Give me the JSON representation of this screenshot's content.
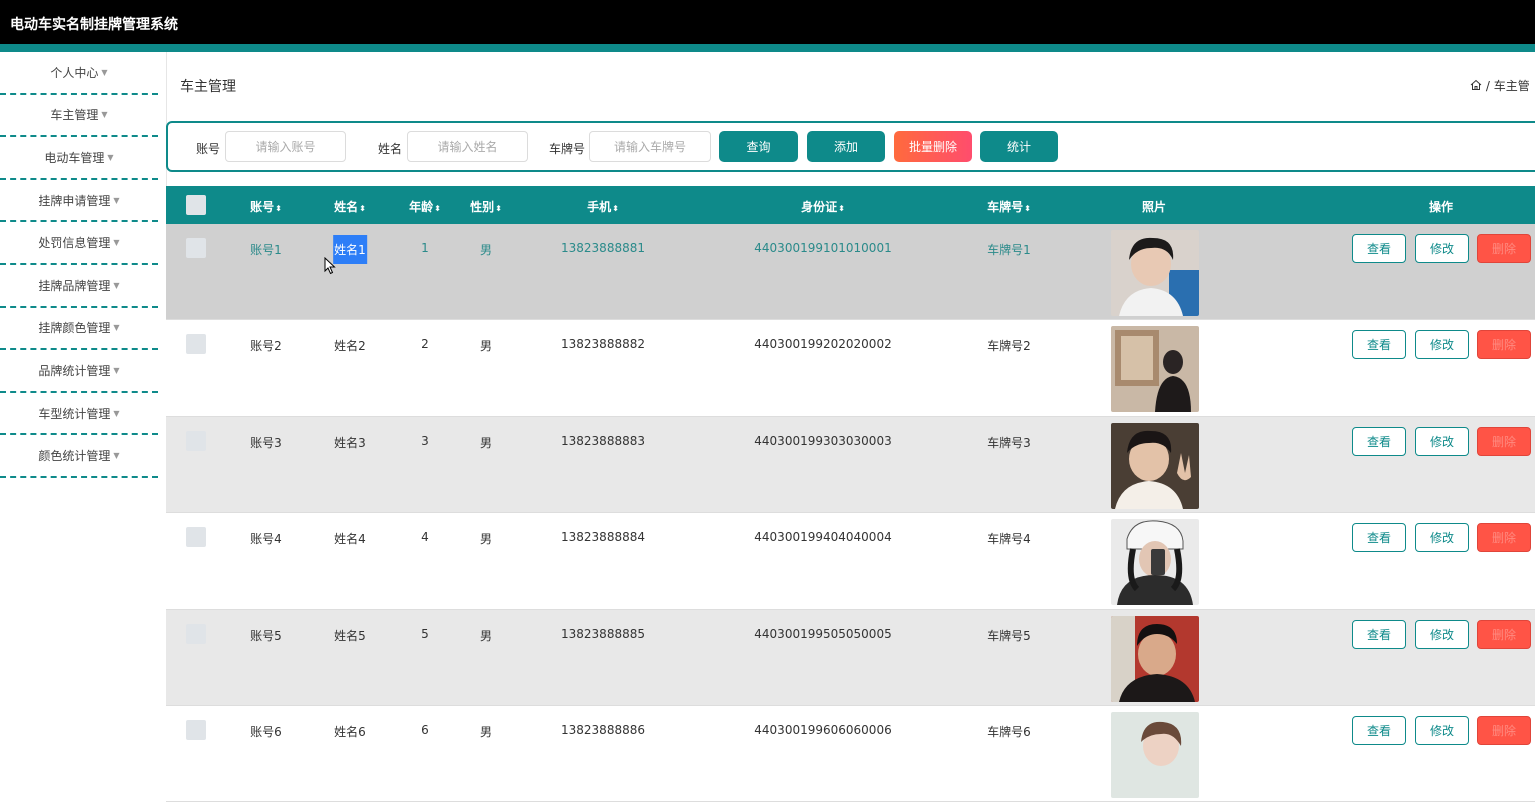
{
  "app": {
    "title": "电动车实名制挂牌管理系统"
  },
  "sidebar": {
    "items": [
      {
        "label": "个人中心"
      },
      {
        "label": "车主管理"
      },
      {
        "label": "电动车管理"
      },
      {
        "label": "挂牌申请管理"
      },
      {
        "label": "处罚信息管理"
      },
      {
        "label": "挂牌品牌管理"
      },
      {
        "label": "挂牌颜色管理"
      },
      {
        "label": "品牌统计管理"
      },
      {
        "label": "车型统计管理"
      },
      {
        "label": "颜色统计管理"
      }
    ]
  },
  "page": {
    "title": "车主管理",
    "breadcrumb_sep": "/",
    "breadcrumb_current": "车主管"
  },
  "search": {
    "account_label": "账号",
    "account_placeholder": "请输入账号",
    "name_label": "姓名",
    "name_placeholder": "请输入姓名",
    "plate_label": "车牌号",
    "plate_placeholder": "请输入车牌号",
    "query_btn": "查询",
    "add_btn": "添加",
    "batch_delete_btn": "批量删除",
    "stats_btn": "统计"
  },
  "table": {
    "headers": {
      "account": "账号",
      "name": "姓名",
      "age": "年龄",
      "gender": "性别",
      "phone": "手机",
      "idcard": "身份证",
      "plate": "车牌号",
      "photo": "照片",
      "ops": "操作"
    },
    "sort_glyph": "⬍",
    "actions": {
      "view": "查看",
      "edit": "修改",
      "delete": "删除"
    },
    "rows": [
      {
        "account": "账号1",
        "name": "姓名1",
        "age": "1",
        "gender": "男",
        "phone": "13823888881",
        "idcard": "440300199101010001",
        "plate": "车牌号1"
      },
      {
        "account": "账号2",
        "name": "姓名2",
        "age": "2",
        "gender": "男",
        "phone": "13823888882",
        "idcard": "440300199202020002",
        "plate": "车牌号2"
      },
      {
        "account": "账号3",
        "name": "姓名3",
        "age": "3",
        "gender": "男",
        "phone": "13823888883",
        "idcard": "440300199303030003",
        "plate": "车牌号3"
      },
      {
        "account": "账号4",
        "name": "姓名4",
        "age": "4",
        "gender": "男",
        "phone": "13823888884",
        "idcard": "440300199404040004",
        "plate": "车牌号4"
      },
      {
        "account": "账号5",
        "name": "姓名5",
        "age": "5",
        "gender": "男",
        "phone": "13823888885",
        "idcard": "440300199505050005",
        "plate": "车牌号5"
      },
      {
        "account": "账号6",
        "name": "姓名6",
        "age": "6",
        "gender": "男",
        "phone": "13823888886",
        "idcard": "440300199606060006",
        "plate": "车牌号6"
      }
    ]
  },
  "colors": {
    "accent": "#0e8a8a",
    "danger": "#ff5446",
    "topbar": "#000000"
  }
}
